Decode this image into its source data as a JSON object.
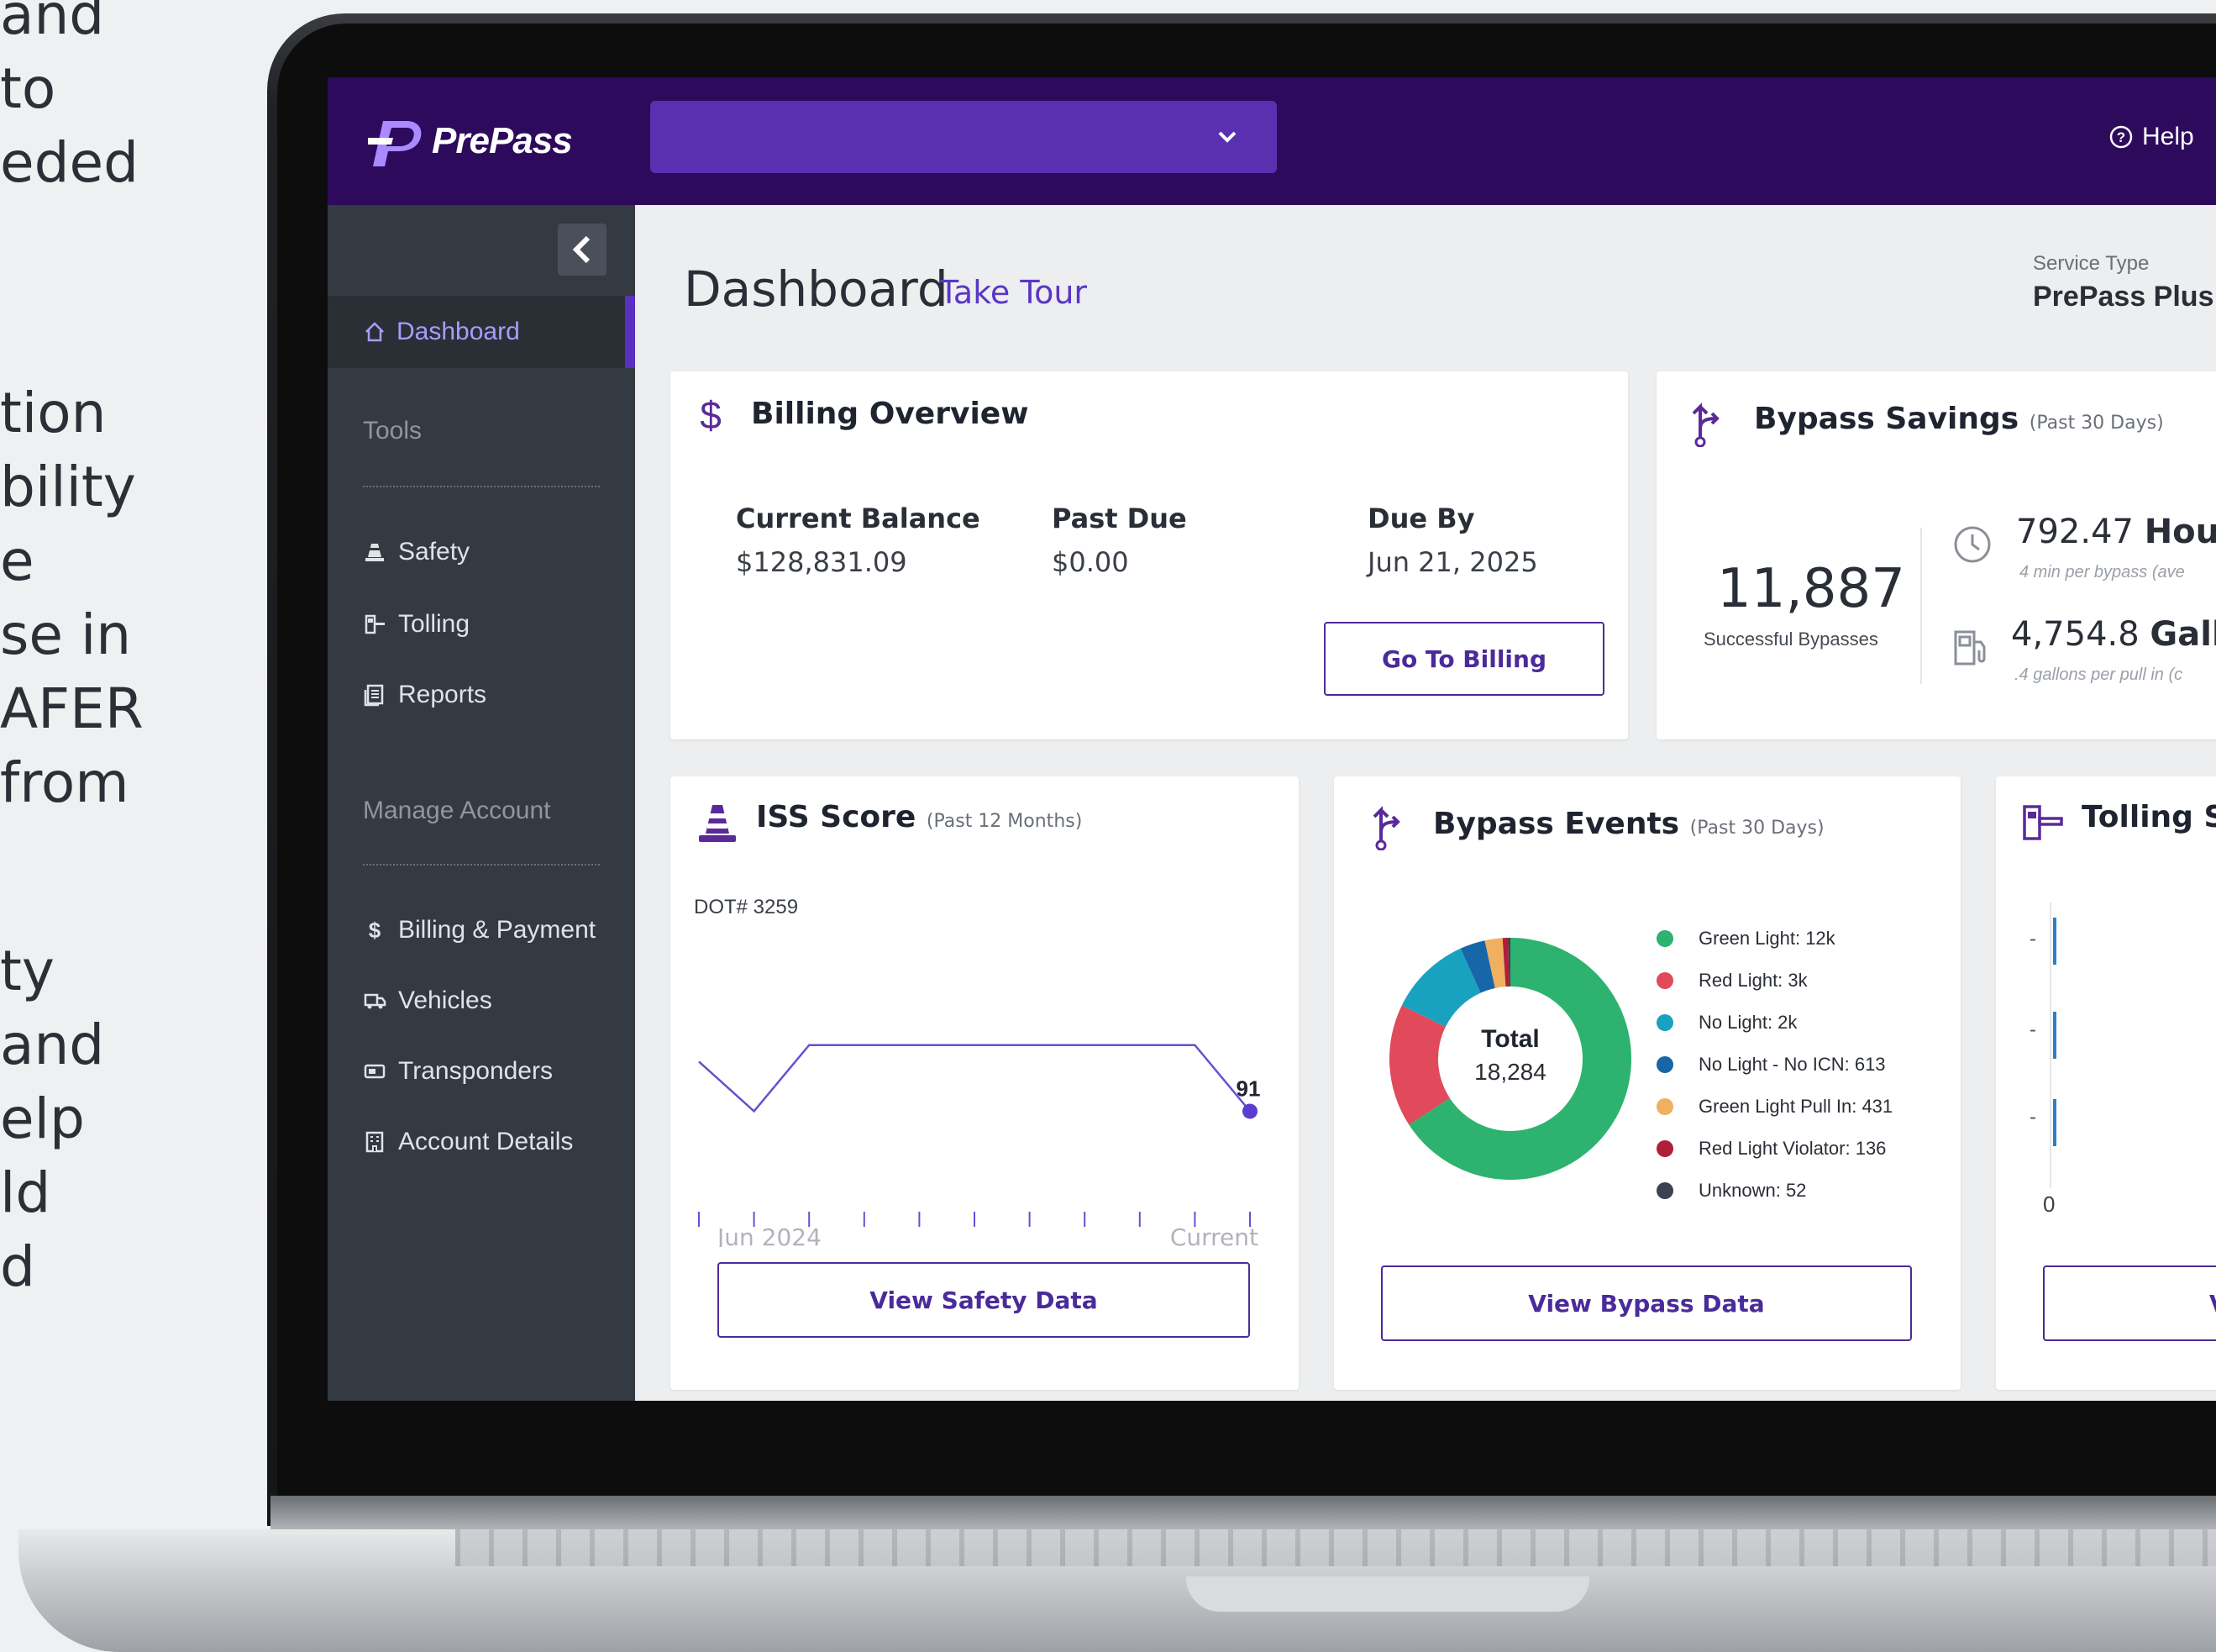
{
  "marketing_text": {
    "line_a": [
      "and",
      "to",
      "eded"
    ],
    "line_b": [
      "tion",
      "bility",
      "e",
      "se in",
      "AFER",
      "from"
    ],
    "line_c": [
      "ty",
      " and",
      "elp",
      "ld",
      "d"
    ]
  },
  "topbar": {
    "logo_text": "PrePass",
    "account_select_value": "",
    "help_label": "Help",
    "colors": {
      "bar": "#2d0a5c",
      "select": "#5a2fb0",
      "accent": "#5b2fc0"
    }
  },
  "sidebar": {
    "active_item": "Dashboard",
    "sections": [
      {
        "title": "Tools",
        "items": [
          {
            "label": "Safety",
            "icon": "cone-icon"
          },
          {
            "label": "Tolling",
            "icon": "toll-gate-icon"
          },
          {
            "label": "Reports",
            "icon": "report-icon"
          }
        ]
      },
      {
        "title": "Manage Account",
        "items": [
          {
            "label": "Billing & Payment",
            "icon": "dollar-icon"
          },
          {
            "label": "Vehicles",
            "icon": "truck-icon"
          },
          {
            "label": "Transponders",
            "icon": "transponder-icon"
          },
          {
            "label": "Account Details",
            "icon": "building-icon"
          }
        ]
      }
    ]
  },
  "header": {
    "title": "Dashboard",
    "take_tour": "Take Tour",
    "service_type_label": "Service Type",
    "service_type_value": "PrePass Plus"
  },
  "billing": {
    "title": "Billing Overview",
    "current_balance_label": "Current Balance",
    "current_balance": "$128,831.09",
    "past_due_label": "Past Due",
    "past_due": "$0.00",
    "due_by_label": "Due By",
    "due_by": "Jun 21, 2025",
    "button": "Go To Billing"
  },
  "bypass_savings": {
    "title": "Bypass Savings",
    "subtitle": "(Past 30 Days)",
    "bypass_count": "11,887",
    "bypass_count_label": "Successful Bypasses",
    "hours_value": "792.47",
    "hours_unit": "Hours",
    "hours_sub": "4 min per bypass (ave",
    "gallons_value": "4,754.8",
    "gallons_unit": "Gallo",
    "gallons_sub": ".4 gallons per pull in (c"
  },
  "iss": {
    "title": "ISS Score",
    "subtitle": "(Past 12 Months)",
    "dot_label": "DOT# 3259",
    "current_score_label": "91",
    "x_start_label": "Jun 2024",
    "x_end_label": "Current",
    "button": "View Safety Data"
  },
  "bypass_events": {
    "title": "Bypass Events",
    "subtitle": "(Past 30 Days)",
    "total_label": "Total",
    "total_value": "18,284",
    "button": "View Bypass Data",
    "legend": [
      {
        "label": "Green Light: 12k",
        "color": "#2db36f"
      },
      {
        "label": "Red Light: 3k",
        "color": "#e04a5a"
      },
      {
        "label": "No Light: 2k",
        "color": "#19a2bf"
      },
      {
        "label": "No Light - No ICN: 613",
        "color": "#1766a8"
      },
      {
        "label": "Green Light Pull In: 431",
        "color": "#f0b060"
      },
      {
        "label": "Red Light Violator: 136",
        "color": "#b01e3a"
      },
      {
        "label": "Unknown: 52",
        "color": "#3c4250"
      }
    ]
  },
  "tolling": {
    "title": "Tolling So",
    "ticks": [
      "-",
      "-",
      "-"
    ],
    "axis_zero": "0",
    "button": "V"
  },
  "chart_data": [
    {
      "type": "line",
      "title": "ISS Score",
      "x": [
        "Jun 2024",
        "",
        "",
        "",
        "",
        "",
        "",
        "",
        "",
        "",
        "Current"
      ],
      "series": [
        {
          "values": [
            97,
            91,
            99,
            99,
            99,
            99,
            99,
            99,
            99,
            99,
            91
          ]
        }
      ],
      "ylim": [
        88,
        101
      ]
    },
    {
      "type": "pie",
      "title": "Bypass Events",
      "categories": [
        "Green Light",
        "Red Light",
        "No Light",
        "No Light - No ICN",
        "Green Light Pull In",
        "Red Light Violator",
        "Unknown"
      ],
      "values": [
        12000,
        3000,
        2000,
        613,
        431,
        136,
        52
      ],
      "colors": [
        "#2db36f",
        "#e04a5a",
        "#19a2bf",
        "#1766a8",
        "#f0b060",
        "#b01e3a",
        "#3c4250"
      ]
    }
  ]
}
